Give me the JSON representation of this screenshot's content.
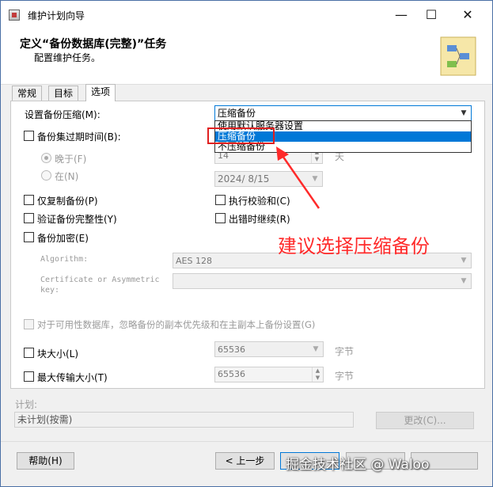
{
  "window": {
    "title": "维护计划向导",
    "minimize": "—",
    "maximize": "☐",
    "close": "✕"
  },
  "header": {
    "title": "定义“备份数据库(完整)”任务",
    "subtitle": "配置维护任务。"
  },
  "tabs": [
    "常规",
    "目标",
    "选项"
  ],
  "options": {
    "compression_label": "设置备份压缩(M):",
    "compression_value": "压缩备份",
    "compression_options": [
      "使用默认服务器设置",
      "压缩备份",
      "不压缩备份"
    ],
    "expire_label": "备份集过期时间(B):",
    "later_label": "晚于(F)",
    "later_value": "14",
    "days_unit": "天",
    "on_label": "在(N)",
    "on_value": "2024/ 8/15",
    "copy_only_label": "仅复制备份(P)",
    "verify_label": "验证备份完整性(Y)",
    "encrypt_label": "备份加密(E)",
    "checksum_label": "执行校验和(C)",
    "continue_label": "出错时继续(R)",
    "algorithm_label": "Algorithm:",
    "algorithm_value": "AES 128",
    "cert_label_1": "Certificate or Asymmetric",
    "cert_label_2": "key:",
    "ag_label": "对于可用性数据库，忽略备份的副本优先级和在主副本上备份设置(G)",
    "block_size_label": "块大小(L)",
    "block_size_value": "65536",
    "block_unit": "字节",
    "max_transfer_label": "最大传输大小(T)",
    "max_transfer_value": "65536",
    "transfer_unit": "字节"
  },
  "annotation": "建议选择压缩备份",
  "schedule": {
    "label": "计划:",
    "value": "未计划(按需)",
    "change_button": "更改(C)..."
  },
  "footer": {
    "help_button": "帮助(H)",
    "back_button": "< 上一步",
    "watermark": "掘金技术社区 @ Waloo"
  }
}
